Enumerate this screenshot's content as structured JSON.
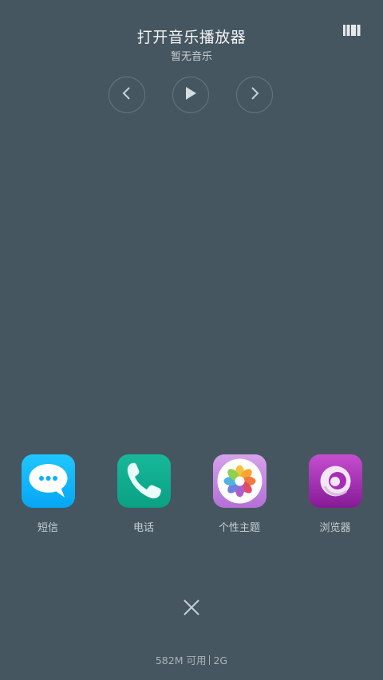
{
  "music_widget": {
    "title": "打开音乐播放器",
    "subtitle": "暂无音乐",
    "controls": {
      "prev_icon": "chevron-left-icon",
      "play_icon": "play-icon",
      "next_icon": "chevron-right-icon"
    }
  },
  "header": {
    "layout_toggle_icon": "grid-layout-icon"
  },
  "recent_apps": [
    {
      "label": "短信",
      "icon": "message-bubble-icon",
      "color": "#0ab0f8"
    },
    {
      "label": "电话",
      "icon": "phone-handset-icon",
      "color": "#12ad90"
    },
    {
      "label": "个性主题",
      "icon": "flower-icon",
      "color": "#c489e0"
    },
    {
      "label": "浏览器",
      "icon": "swirl-icon",
      "color": "#a630b5"
    }
  ],
  "footer": {
    "close_icon": "close-icon",
    "memory_available": "582M 可用",
    "ram_total": "2G"
  },
  "colors": {
    "background": "#465660",
    "text_primary": "#f2f4f5",
    "text_secondary": "#c7ced2"
  }
}
